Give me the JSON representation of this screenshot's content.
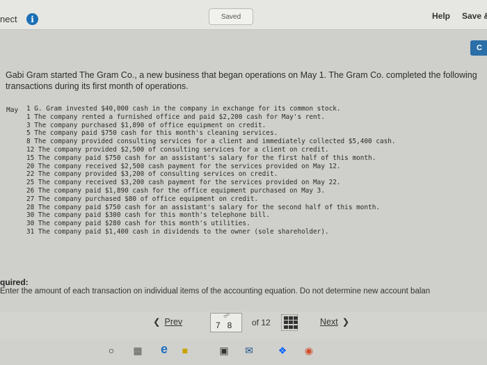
{
  "header": {
    "connect_label": "nect",
    "info_icon": "i",
    "saved_label": "Saved",
    "help_label": "Help",
    "save_label": "Save &",
    "corner_button_label": "C"
  },
  "problem": {
    "intro": "Gabi Gram started The Gram Co., a new business that began operations on May 1. The Gram Co. completed the following transactions during its first month of operations.",
    "month_label": "May",
    "transactions": [
      "1 G. Gram invested $40,000 cash in the company in exchange for its common stock.",
      "1 The company rented a furnished office and paid $2,200 cash for May's rent.",
      "3 The company purchased $1,890 of office equipment on credit.",
      "5 The company paid $750 cash for this month's cleaning services.",
      "8 The company provided consulting services for a client and immediately collected $5,400 cash.",
      "12 The company provided $2,500 of consulting services for a client on credit.",
      "15 The company paid $750 cash for an assistant's salary for the first half of this month.",
      "20 The company received $2,500 cash payment for the services provided on May 12.",
      "22 The company provided $3,200 of consulting services on credit.",
      "25 The company received $3,200 cash payment for the services provided on May 22.",
      "26 The company paid $1,890 cash for the office equipment purchased on May 3.",
      "27 The company purchased $80 of office equipment on credit.",
      "28 The company paid $750 cash for an assistant's salary for the second half of this month.",
      "30 The company paid $300 cash for this month's telephone bill.",
      "30 The company paid $280 cash for this month's utilities.",
      "31 The company paid $1,400 cash in dividends to the owner (sole shareholder)."
    ]
  },
  "requirement": {
    "title": "quired:",
    "text": "Enter the amount of each transaction on individual items of the accounting equation. Do not determine new account balan"
  },
  "pagination": {
    "prev_label": "Prev",
    "current_pages": "7   8",
    "of_label": "of 12",
    "next_label": "Next"
  },
  "taskbar": {
    "icons": [
      "search-circle-icon",
      "task-view-icon",
      "edge-browser-icon",
      "file-explorer-icon",
      "store-icon",
      "mail-icon",
      "dropbox-icon",
      "chrome-icon"
    ]
  }
}
